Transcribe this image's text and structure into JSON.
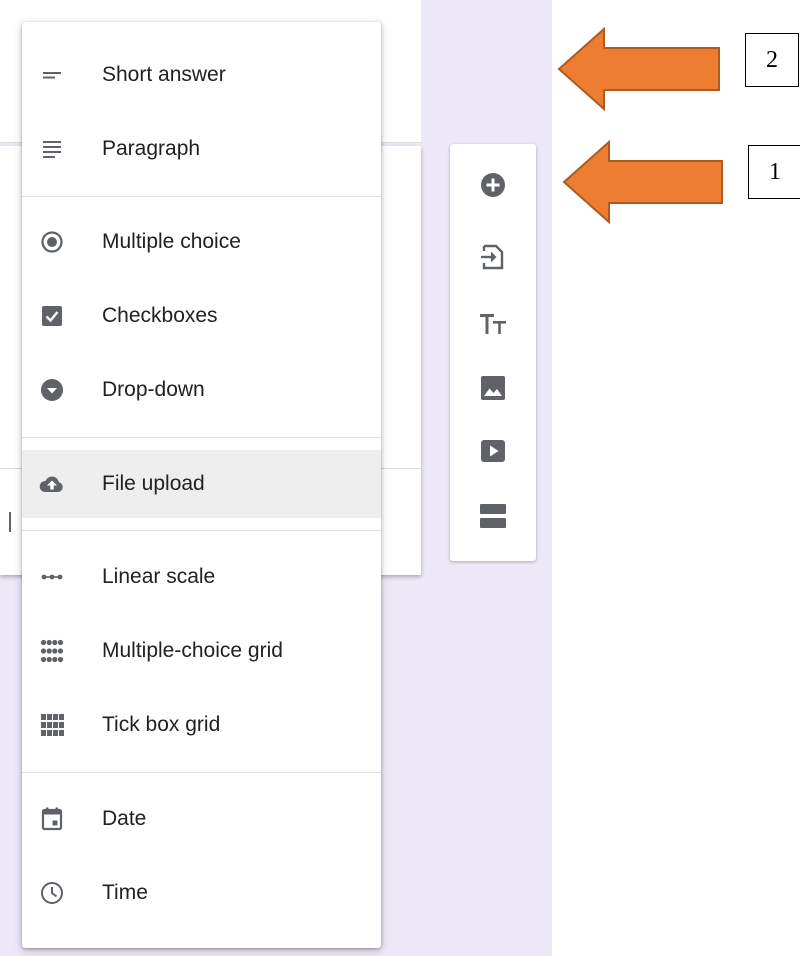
{
  "menu": {
    "items": [
      {
        "label": "Short answer",
        "icon": "short-answer-icon"
      },
      {
        "label": "Paragraph",
        "icon": "paragraph-icon"
      },
      {
        "label": "Multiple choice",
        "icon": "radio-button-icon"
      },
      {
        "label": "Checkboxes",
        "icon": "checkbox-icon"
      },
      {
        "label": "Drop-down",
        "icon": "dropdown-icon"
      },
      {
        "label": "File upload",
        "icon": "cloud-upload-icon",
        "selected": true
      },
      {
        "label": "Linear scale",
        "icon": "linear-scale-icon"
      },
      {
        "label": "Multiple-choice grid",
        "icon": "dot-grid-icon"
      },
      {
        "label": "Tick box grid",
        "icon": "tick-grid-icon"
      },
      {
        "label": "Date",
        "icon": "calendar-icon"
      },
      {
        "label": "Time",
        "icon": "clock-icon"
      }
    ]
  },
  "toolbar": {
    "buttons": [
      {
        "icon": "add-question-icon"
      },
      {
        "icon": "import-questions-icon"
      },
      {
        "icon": "title-description-icon"
      },
      {
        "icon": "image-icon"
      },
      {
        "icon": "video-icon"
      },
      {
        "icon": "section-icon"
      }
    ]
  },
  "callouts": [
    {
      "label": "2"
    },
    {
      "label": "1"
    }
  ],
  "colors": {
    "canvas_background": "#ede8f7",
    "icon_gray": "#5f6368",
    "selected_background": "#eeeeee",
    "arrow_fill": "#ed7d31",
    "arrow_stroke": "#ae5a21"
  }
}
